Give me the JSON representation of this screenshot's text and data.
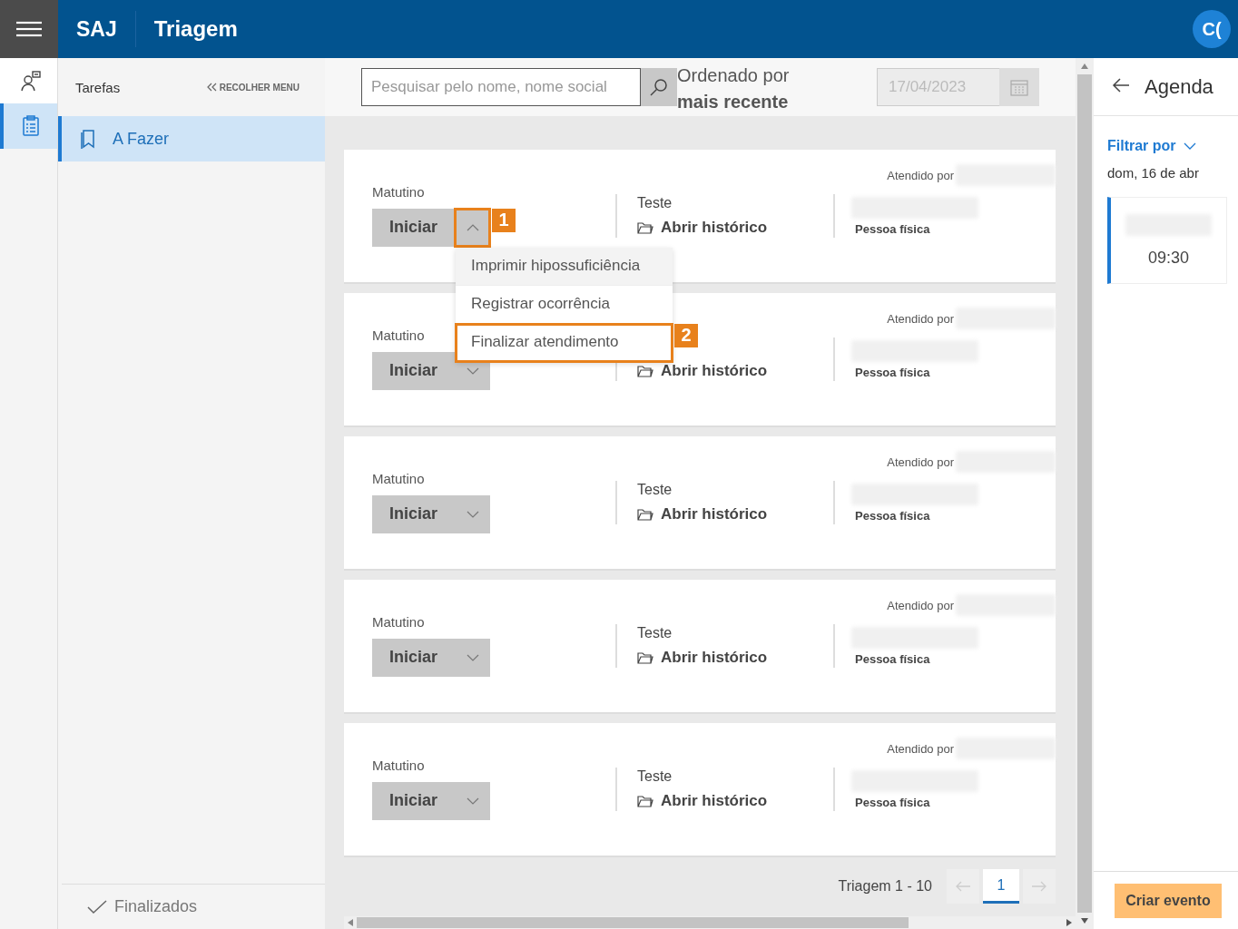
{
  "header": {
    "logo": "SAJ",
    "title": "Triagem",
    "avatar": "C("
  },
  "rail": [
    {
      "kind": "person",
      "selected": false
    },
    {
      "kind": "clipboard",
      "selected": true
    }
  ],
  "sidebar": {
    "title": "Tarefas",
    "collapse": "RECOLHER MENU",
    "items": [
      {
        "label": "A Fazer",
        "selected": true
      }
    ],
    "footer": "Finalizados"
  },
  "toolbar": {
    "search": {
      "placeholder": "Pesquisar pelo nome, nome social"
    },
    "sort_label": "Ordenado por",
    "sort_value": "mais recente",
    "date": {
      "placeholder": "17/04/2023"
    }
  },
  "cards": [
    {
      "shift": "Matutino",
      "button": "Iniciar",
      "expanded": true,
      "callout": "1",
      "menu": [
        {
          "label": "Imprimir hipossuficiência",
          "highlighted": true
        },
        {
          "label": "Registrar ocorrência",
          "highlighted": false
        },
        {
          "label": "Finalizar atendimento",
          "highlighted": false,
          "callout": "2"
        }
      ],
      "service": "Teste",
      "history": "Abrir histórico",
      "attended": "Atendido por",
      "person_type": "Pessoa física"
    },
    {
      "shift": "Matutino",
      "button": "Iniciar",
      "expanded": false,
      "history": "Abrir histórico",
      "attended": "Atendido por",
      "person_type": "Pessoa física"
    },
    {
      "shift": "Matutino",
      "button": "Iniciar",
      "expanded": false,
      "service": "Teste",
      "history": "Abrir histórico",
      "attended": "Atendido por",
      "person_type": "Pessoa física"
    },
    {
      "shift": "Matutino",
      "button": "Iniciar",
      "expanded": false,
      "service": "Teste",
      "history": "Abrir histórico",
      "attended": "Atendido por",
      "person_type": "Pessoa física"
    },
    {
      "shift": "Matutino",
      "button": "Iniciar",
      "expanded": false,
      "service": "Teste",
      "history": "Abrir histórico",
      "attended": "Atendido por",
      "person_type": "Pessoa física"
    }
  ],
  "pagination": {
    "label": "Triagem 1 - 10",
    "pages": [
      {
        "label": "1",
        "selected": true
      }
    ]
  },
  "agenda": {
    "title": "Agenda",
    "filter": "Filtrar por",
    "date": "dom, 16 de abr",
    "events": [
      {
        "time": "09:30"
      }
    ],
    "create": "Criar evento"
  }
}
